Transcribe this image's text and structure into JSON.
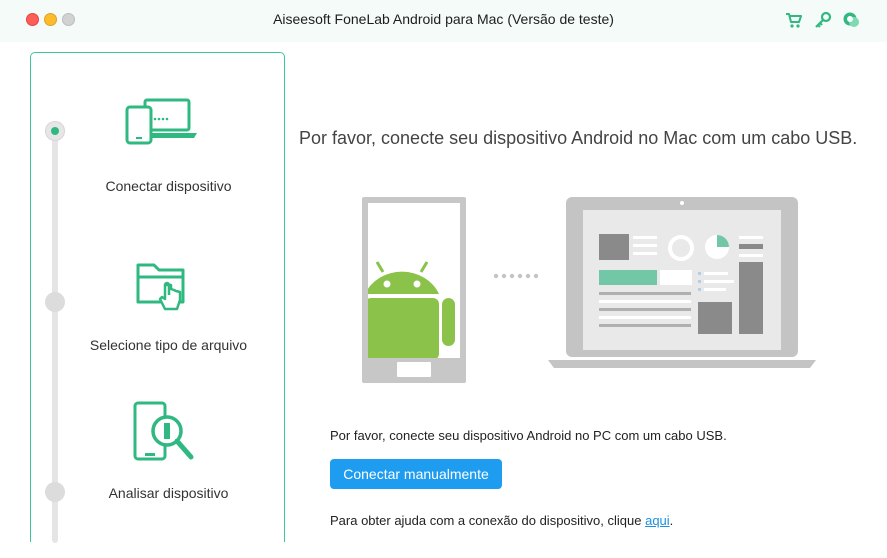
{
  "window": {
    "title": "Aiseesoft FoneLab Android para Mac (Versão de teste)"
  },
  "toolbar_icons": [
    "cart-icon",
    "key-icon",
    "chat-support-icon"
  ],
  "colors": {
    "accent_green": "#2fb880",
    "button_blue": "#1e9cf0",
    "link_blue": "#1e8fe0"
  },
  "sidebar": {
    "steps": [
      {
        "label": "Conectar dispositivo",
        "icon": "connect-device-icon",
        "active": true
      },
      {
        "label": "Selecione tipo de arquivo",
        "icon": "folder-select-icon",
        "active": false
      },
      {
        "label": "Analisar dispositivo",
        "icon": "scan-device-icon",
        "active": false
      }
    ]
  },
  "main": {
    "headline": "Por favor, conecte seu dispositivo Android no Mac com um cabo USB.",
    "instruction": "Por favor, conecte seu dispositivo Android no PC com um cabo USB.",
    "connect_button": "Conectar manualmente",
    "help_prefix": "Para obter ajuda com a conexão do dispositivo, clique ",
    "help_link": "aqui",
    "help_suffix": "."
  }
}
